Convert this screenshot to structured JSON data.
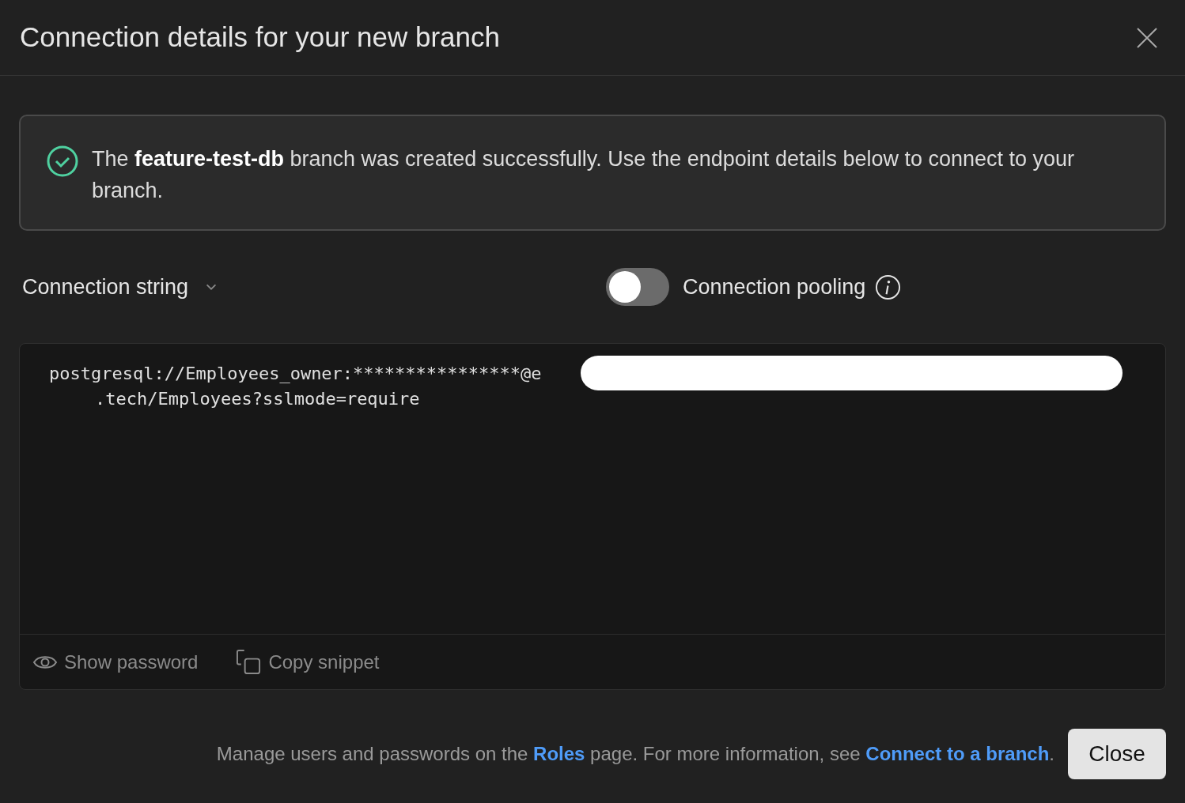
{
  "dialog": {
    "title": "Connection details for your new branch"
  },
  "alert": {
    "message": "The **feature-test-db** branch was created successfully. Use the endpoint details below to connect to your branch."
  },
  "connection_type": {
    "label": "Connection string"
  },
  "pooling": {
    "label": "Connection pooling",
    "on": false
  },
  "code": {
    "lines": [
      "postgresql://Employees_owner:****************@e",
      ".tech/Employees?sslmode=require"
    ]
  },
  "code_actions": [
    {
      "kind": "eye",
      "label": "Show password"
    },
    {
      "kind": "copy",
      "label": "Copy snippet"
    }
  ],
  "footer": {
    "segments": [
      {
        "kind": "text",
        "text": "Manage users and passwords on the "
      },
      {
        "kind": "link",
        "text": "Roles"
      },
      {
        "kind": "text",
        "text": " page. For more information, see "
      },
      {
        "kind": "link",
        "text": "Connect to a branch"
      },
      {
        "kind": "text",
        "text": "."
      }
    ],
    "button": "Close"
  }
}
